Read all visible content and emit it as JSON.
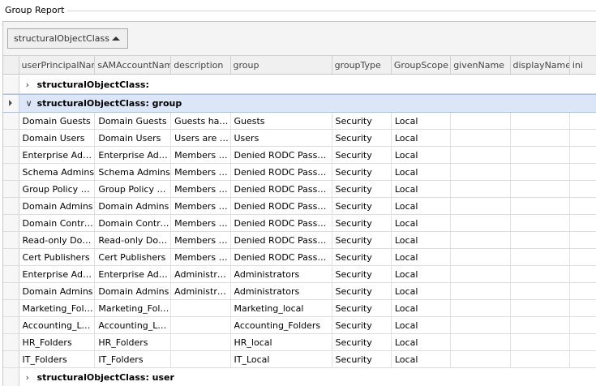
{
  "window": {
    "groupbox_title": "Group Report"
  },
  "group_panel": {
    "chip_label": "structuralObjectClass"
  },
  "columns": [
    {
      "label": "userPrincipalName",
      "w": 96
    },
    {
      "label": "sAMAccountName",
      "w": 96
    },
    {
      "label": "description",
      "w": 75
    },
    {
      "label": "group",
      "w": 128
    },
    {
      "label": "groupType",
      "w": 75
    },
    {
      "label": "GroupScope",
      "w": 75
    },
    {
      "label": "givenName",
      "w": 75
    },
    {
      "label": "displayName",
      "w": 75
    },
    {
      "label": "ini",
      "w": 40
    }
  ],
  "groups": [
    {
      "label": "structuralObjectClass:",
      "expanded": false,
      "focused": false,
      "rows": []
    },
    {
      "label": "structuralObjectClass: group",
      "expanded": true,
      "focused": true,
      "rows": [
        [
          "Domain Guests",
          "Domain Guests",
          "Guests hav…",
          "Guests",
          "Security",
          "Local",
          "",
          "",
          ""
        ],
        [
          "Domain Users",
          "Domain Users",
          "Users are p…",
          "Users",
          "Security",
          "Local",
          "",
          "",
          ""
        ],
        [
          "Enterprise Admins",
          "Enterprise Admins",
          "Members in …",
          "Denied RODC Passwor…",
          "Security",
          "Local",
          "",
          "",
          ""
        ],
        [
          "Schema Admins",
          "Schema Admins",
          "Members in …",
          "Denied RODC Passwor…",
          "Security",
          "Local",
          "",
          "",
          ""
        ],
        [
          "Group Policy Cre…",
          "Group Policy Cre…",
          "Members in …",
          "Denied RODC Passwor…",
          "Security",
          "Local",
          "",
          "",
          ""
        ],
        [
          "Domain Admins",
          "Domain Admins",
          "Members in …",
          "Denied RODC Passwor…",
          "Security",
          "Local",
          "",
          "",
          ""
        ],
        [
          "Domain Controll…",
          "Domain Controll…",
          "Members in …",
          "Denied RODC Passwor…",
          "Security",
          "Local",
          "",
          "",
          ""
        ],
        [
          "Read-only Doma…",
          "Read-only Doma…",
          "Members in …",
          "Denied RODC Passwor…",
          "Security",
          "Local",
          "",
          "",
          ""
        ],
        [
          "Cert Publishers",
          "Cert Publishers",
          "Members in …",
          "Denied RODC Passwor…",
          "Security",
          "Local",
          "",
          "",
          ""
        ],
        [
          "Enterprise Admins",
          "Enterprise Admins",
          "Administrat…",
          "Administrators",
          "Security",
          "Local",
          "",
          "",
          ""
        ],
        [
          "Domain Admins",
          "Domain Admins",
          "Administrat…",
          "Administrators",
          "Security",
          "Local",
          "",
          "",
          ""
        ],
        [
          "Marketing_Folders",
          "Marketing_Folders",
          "",
          "Marketing_local",
          "Security",
          "Local",
          "",
          "",
          ""
        ],
        [
          "Accounting_Local",
          "Accounting_Local",
          "",
          "Accounting_Folders",
          "Security",
          "Local",
          "",
          "",
          ""
        ],
        [
          "HR_Folders",
          "HR_Folders",
          "",
          "HR_local",
          "Security",
          "Local",
          "",
          "",
          ""
        ],
        [
          "IT_Folders",
          "IT_Folders",
          "",
          "IT_Local",
          "Security",
          "Local",
          "",
          "",
          ""
        ]
      ]
    },
    {
      "label": "structuralObjectClass: user",
      "expanded": false,
      "focused": false,
      "rows": []
    }
  ]
}
